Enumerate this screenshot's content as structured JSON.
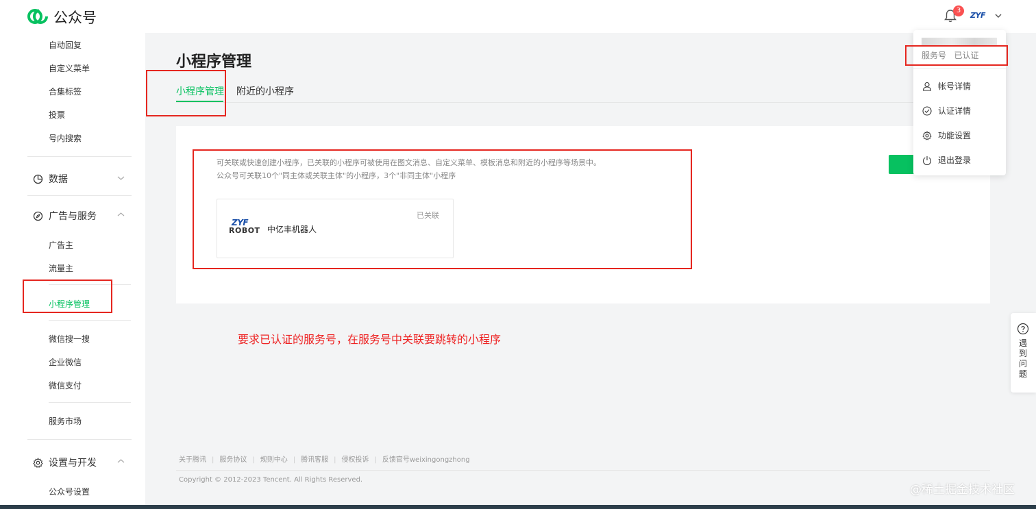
{
  "header": {
    "brand": "公众号",
    "notification_count": "3",
    "avatar_text": "ZYF"
  },
  "sidebar": {
    "items_top": [
      "自动回复",
      "自定义菜单",
      "合集标签",
      "投票",
      "号内搜索"
    ],
    "group_data": "数据",
    "group_ads": "广告与服务",
    "ads_items": [
      "广告主",
      "流量主"
    ],
    "mini_program": "小程序管理",
    "items_mid": [
      "微信搜一搜",
      "企业微信",
      "微信支付"
    ],
    "market": "服务市场",
    "group_settings": "设置与开发",
    "settings_items": [
      "公众号设置"
    ]
  },
  "main": {
    "title": "小程序管理",
    "tabs": [
      "小程序管理",
      "附近的小程序"
    ],
    "desc_line1": "可关联或快速创建小程序，已关联的小程序可被使用在图文消息、自定义菜单、模板消息和附近的小程序等场景中。",
    "desc_line2": "公众号可关联10个\"同主体或关联主体\"的小程序，3个\"非同主体\"小程序",
    "mp": {
      "logo_line1": "ZYF",
      "logo_line2": "ROBOT",
      "name": "中亿丰机器人",
      "status": "已关联"
    },
    "note": "要求已认证的服务号，在服务号中关联要跳转的小程序"
  },
  "dropdown": {
    "account_type": "服务号",
    "verified": "已认证",
    "items": [
      "帐号详情",
      "认证详情",
      "功能设置",
      "退出登录"
    ]
  },
  "help": {
    "text": "遇到问题"
  },
  "footer": {
    "links": [
      "关于腾讯",
      "服务协议",
      "规则中心",
      "腾讯客服",
      "侵权投诉",
      "反馈官号weixingongzhong"
    ],
    "copyright": "Copyright © 2012-2023 Tencent. All Rights Reserved.",
    "watermark": "@稀土掘金技术社区"
  },
  "colors": {
    "accent": "#07c160",
    "annotation": "#e5261f",
    "badge": "#fa5151"
  }
}
